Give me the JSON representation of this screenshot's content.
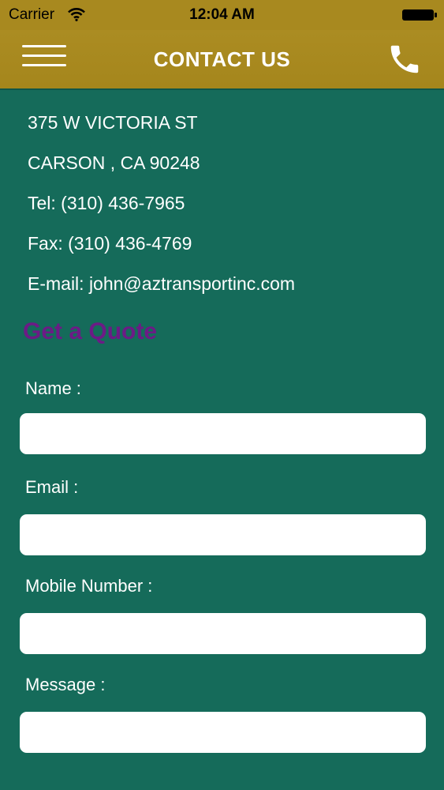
{
  "status_bar": {
    "carrier": "Carrier",
    "time": "12:04 AM"
  },
  "nav": {
    "title": "CONTACT US",
    "menu_icon": "hamburger-menu-icon",
    "call_icon": "phone-icon"
  },
  "contact": {
    "address_line1": "375 W VICTORIA ST",
    "address_line2": "CARSON , CA 90248",
    "tel": "Tel: (310) 436-7965",
    "fax": "Fax: (310) 436-4769",
    "email": "E-mail: john@aztransportinc.com"
  },
  "quote": {
    "title": "Get a Quote",
    "fields": {
      "name": {
        "label": "Name :",
        "value": "",
        "placeholder": ""
      },
      "email": {
        "label": "Email :",
        "value": "",
        "placeholder": ""
      },
      "mobile": {
        "label": "Mobile Number :",
        "value": "",
        "placeholder": ""
      },
      "message": {
        "label": "Message :",
        "value": "",
        "placeholder": ""
      }
    }
  },
  "colors": {
    "header_gold": "#a8891f",
    "body_green": "#156b5a",
    "quote_purple": "#6c1b86"
  }
}
